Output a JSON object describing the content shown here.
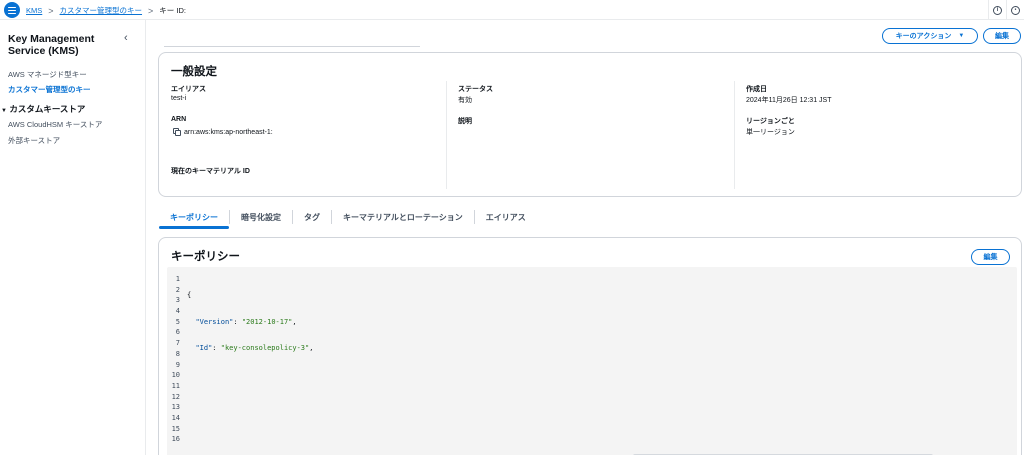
{
  "topbar": {
    "menu_icon": "hamburger-icon",
    "breadcrumbs": [
      "KMS",
      "カスタマー管理型のキー",
      "キー ID: "
    ],
    "separator": ">",
    "info_icon": "i",
    "notifications_icon": "circle-icon"
  },
  "sidebar": {
    "title": "Key Management Service (KMS)",
    "close_glyph": "‹",
    "items": [
      {
        "label": "AWS マネージド型キー"
      },
      {
        "label": "カスタマー管理型のキー"
      }
    ],
    "group": {
      "label": "カスタムキーストア",
      "arrow": "▼",
      "items": [
        {
          "label": "AWS CloudHSM キーストア"
        },
        {
          "label": "外部キーストア"
        }
      ]
    }
  },
  "actions": {
    "key_actions_label": "キーのアクション",
    "dropdown_glyph": "▼",
    "edit_label": "編集"
  },
  "general": {
    "title": "一般設定",
    "alias_label": "エイリアス",
    "alias_value": "test-i",
    "arn_label": "ARN",
    "arn_value": "arn:aws:kms:ap-northeast-1:",
    "key_material_label": "現在のキーマテリアル ID",
    "status_label": "ステータス",
    "status_value": "有効",
    "description_label": "説明",
    "created_label": "作成日",
    "created_value": "2024年11月26日 12:31 JST",
    "region_label": "リージョンごと",
    "region_value": "単一リージョン"
  },
  "tabs": [
    "キーポリシー",
    "暗号化設定",
    "タグ",
    "キーマテリアルとローテーション",
    "エイリアス"
  ],
  "policy": {
    "title": "キーポリシー",
    "edit_label": "編集",
    "line_numbers": [
      "1",
      "2",
      "3",
      "4",
      "5",
      "6",
      "7",
      "8",
      "9",
      "10",
      "11",
      "12",
      "13",
      "14",
      "15",
      "16"
    ],
    "lines": [
      {
        "text": "{"
      },
      {
        "key": "\"Version\"",
        "sep": ": ",
        "value": "\"2012-10-17\"",
        "end": ","
      },
      {
        "key": "\"Id\"",
        "sep": ": ",
        "value": "\"key-consolepolicy-3\"",
        "end": ","
      }
    ]
  }
}
